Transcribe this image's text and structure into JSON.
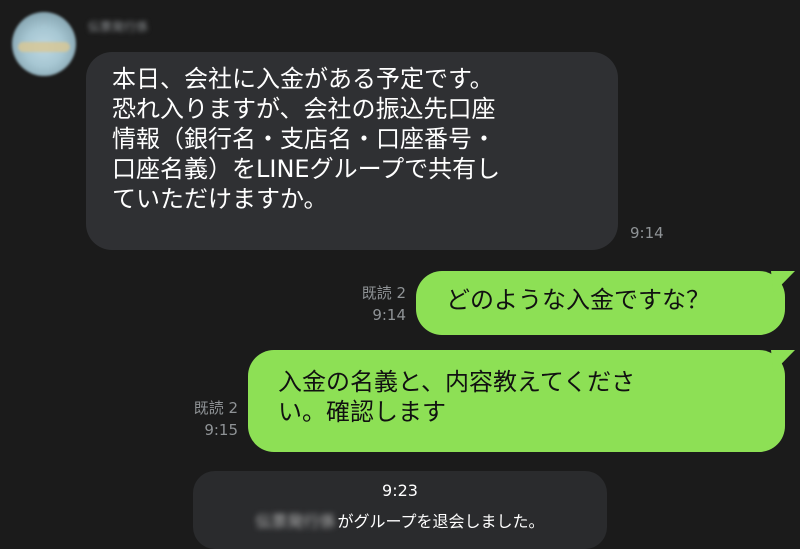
{
  "chat": {
    "sender_name": "伝票発行係",
    "incoming": {
      "text": "本日、会社に入金がある予定です。\n恐れ入りますが、会社の振込先口座\n情報（銀行名・支店名・口座番号・\n口座名義）をLINEグループで共有し\nていただけますか。",
      "time": "9:14"
    },
    "outgoing": [
      {
        "text": "どのような入金ですな？",
        "read": "既読 2",
        "time": "9:14"
      },
      {
        "text": "入金の名義と、内容教えてくださ\nい。確認します",
        "read": "既読 2",
        "time": "9:15"
      }
    ],
    "system": {
      "time": "9:23",
      "hidden_name": "伝票発行係",
      "message": "がグループを退会しました。"
    }
  },
  "colors": {
    "background": "#1b1b1b",
    "incoming_bubble": "#2f3033",
    "outgoing_bubble": "#8de055",
    "meta_text": "#8f9396"
  }
}
